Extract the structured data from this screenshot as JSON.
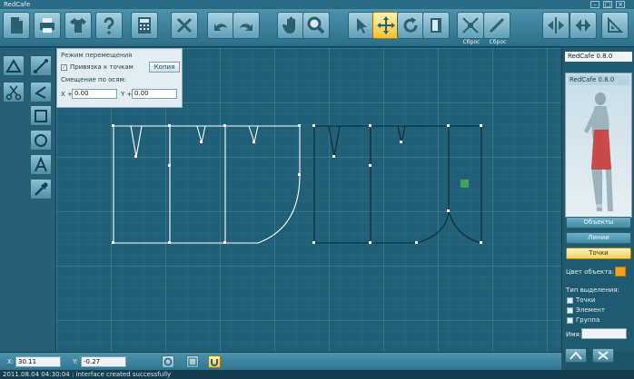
{
  "window": {
    "title": "RedCafe"
  },
  "toolbar": {
    "reset_label": "Сброс"
  },
  "move_panel": {
    "header": "Режим перемещения",
    "snap_label": "Привязка к точкам",
    "snap_checked": true,
    "copy_button": "Копия",
    "offset_label": "Смещение по осям:",
    "x_label": "X +",
    "x_value": "0.00",
    "y_label": "Y +",
    "y_value": "0.00"
  },
  "right_panel": {
    "title": "RedCafe 0.8.0",
    "list_item": "RedCafe 0.8.0",
    "selection_label": "Выделение:",
    "selection_count": "0",
    "btn_objects": "Объекты",
    "btn_lines": "Линии",
    "btn_points": "Точки",
    "color_label": "Цвет объекта:",
    "object_color": "#f5a21a",
    "selection_type_label": "Тип выделения:",
    "sel_points": "Точки",
    "sel_element": "Элемент",
    "sel_group": "Группа",
    "name_label": "Имя:"
  },
  "status": {
    "x_label": "X:",
    "x_value": "30.11",
    "y_label": "Y:",
    "y_value": "-0.27"
  },
  "log": {
    "message": "2011.08.04 04:30:04 : interface created successfully"
  },
  "icons": [
    "document-icon",
    "printer-icon",
    "shirt-icon",
    "help-icon",
    "calculator-icon",
    "cut-tool-icon",
    "undo-icon",
    "redo-icon",
    "hand-icon",
    "zoom-icon",
    "pointer-icon",
    "move-icon",
    "rotate-icon",
    "page-icon",
    "reset-point-icon",
    "reset-line-icon",
    "mirror-vertical-icon",
    "mirror-horizontal-icon",
    "measure-icon"
  ]
}
